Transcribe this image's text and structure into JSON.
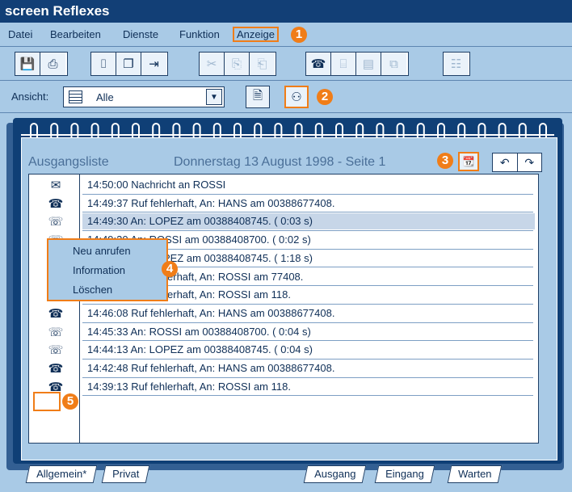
{
  "app_title": "screen Reflexes",
  "menu": [
    "Datei",
    "Bearbeiten",
    "Dienste",
    "Funktion",
    "Anzeige"
  ],
  "callouts": [
    "1",
    "2",
    "3",
    "4",
    "5"
  ],
  "toolbar_groups": [
    [
      "save-icon",
      "print-icon"
    ],
    [
      "fax-icon",
      "copy-screen-icon",
      "exit-icon"
    ],
    [
      "cut-icon",
      "copy-icon",
      "paste-icon"
    ],
    [
      "phone-icon",
      "fax-disabled-icon",
      "card-icon",
      "cards-icon"
    ],
    [
      "properties-icon"
    ]
  ],
  "view": {
    "label": "Ansicht:",
    "value": "Alle"
  },
  "list_header": {
    "title": "Ausgangsliste",
    "date": "Donnerstag 13 August 1998 - Seite 1"
  },
  "rows": [
    {
      "icon": "message-icon",
      "text": "14:50:00  Nachricht an ROSSI"
    },
    {
      "icon": "phone-icon",
      "text": "14:49:37  Ruf fehlerhaft, An: HANS am 00388677408."
    },
    {
      "icon": "phone-outline-icon",
      "text": "14:49:30  An: LOPEZ am 00388408745. (  0:03 s)"
    },
    {
      "icon": "phone-outline-icon",
      "text": "14:49:20  An: ROSSI am 00388408700. (  0:02 s)"
    },
    {
      "icon": "phone-outline-icon",
      "text": "14:48:53  An: LOPEZ am 00388408745. (  1:18 s)"
    },
    {
      "icon": "phone-icon",
      "text": "14:47:04  Ruf fehlerhaft, An: ROSSI am 77408."
    },
    {
      "icon": "phone-icon",
      "text": "14:46:41  Ruf fehlerhaft, An: ROSSI am 118."
    },
    {
      "icon": "phone-icon",
      "text": "14:46:08  Ruf fehlerhaft, An: HANS am 00388677408."
    },
    {
      "icon": "phone-outline-icon",
      "text": "14:45:33  An: ROSSI am 00388408700. (  0:04 s)"
    },
    {
      "icon": "phone-outline-icon",
      "text": "14:44:13  An: LOPEZ am 00388408745. (  0:04 s)"
    },
    {
      "icon": "phone-icon",
      "text": "14:42:48  Ruf fehlerhaft, An: HANS am 00388677408."
    },
    {
      "icon": "phone-icon",
      "text": "14:39:13  Ruf fehlerhaft, An: ROSSI am 118."
    }
  ],
  "context_menu": [
    "Neu anrufen",
    "Information",
    "Löschen"
  ],
  "tabs_left": [
    "Allgemein*",
    "Privat"
  ],
  "tabs_right": [
    "Ausgang",
    "Eingang",
    "Warten"
  ]
}
